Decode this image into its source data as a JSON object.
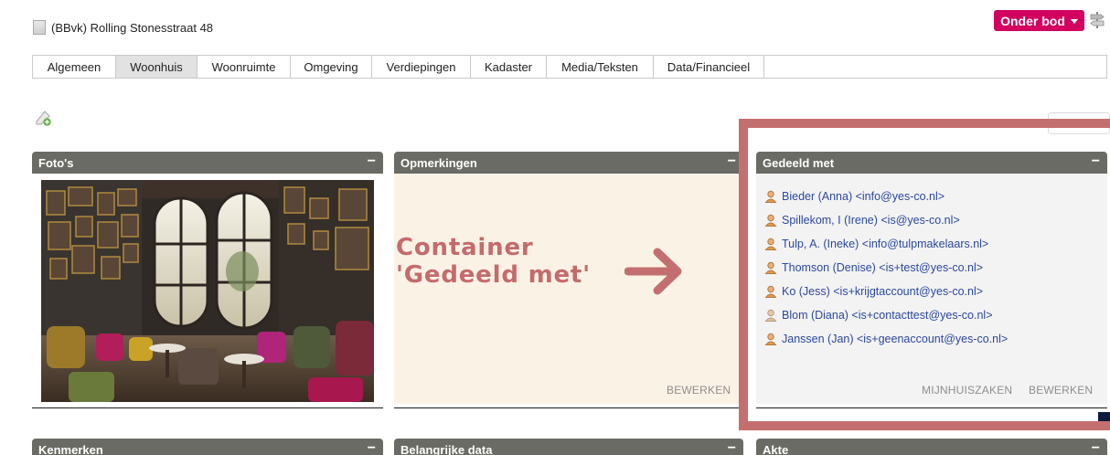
{
  "header": {
    "title": "(BBvk) Rolling Stonesstraat 48",
    "status_label": "Onder bod",
    "status_color": "#d2005f"
  },
  "tabs": [
    {
      "label": "Algemeen",
      "active": false
    },
    {
      "label": "Woonhuis",
      "active": true
    },
    {
      "label": "Woonruimte",
      "active": false
    },
    {
      "label": "Omgeving",
      "active": false
    },
    {
      "label": "Verdiepingen",
      "active": false
    },
    {
      "label": "Kadaster",
      "active": false
    },
    {
      "label": "Media/Teksten",
      "active": false
    },
    {
      "label": "Data/Financieel",
      "active": false
    }
  ],
  "panels": {
    "fotos": {
      "title": "Foto's",
      "collapse": "−"
    },
    "opmerkingen": {
      "title": "Opmerkingen",
      "collapse": "−",
      "edit_label": "BEWERKEN"
    },
    "gedeeld": {
      "title": "Gedeeld met",
      "collapse": "−",
      "items": [
        "Bieder (Anna) <info@yes-co.nl>",
        "Spillekom, I (Irene) <is@yes-co.nl>",
        "Tulp, A. (Ineke) <info@tulpmakelaars.nl>",
        "Thomson (Denise) <is+test@yes-co.nl>",
        "Ko (Jess) <is+krijgtaccount@yes-co.nl>",
        "Blom (Diana) <is+contacttest@yes-co.nl>",
        "Janssen (Jan) <is+geenaccount@yes-co.nl>"
      ],
      "mijnhuiszaken_label": "MIJNHUISZAKEN",
      "edit_label": "BEWERKEN"
    },
    "kenmerken": {
      "title": "Kenmerken",
      "collapse": "−"
    },
    "belangrijke_data": {
      "title": "Belangrijke data",
      "collapse": "−"
    },
    "akte": {
      "title": "Akte",
      "collapse": "−"
    }
  },
  "annotation": {
    "line1": "Container",
    "line2": "'Gedeeld met'",
    "color": "#c46f6f"
  }
}
